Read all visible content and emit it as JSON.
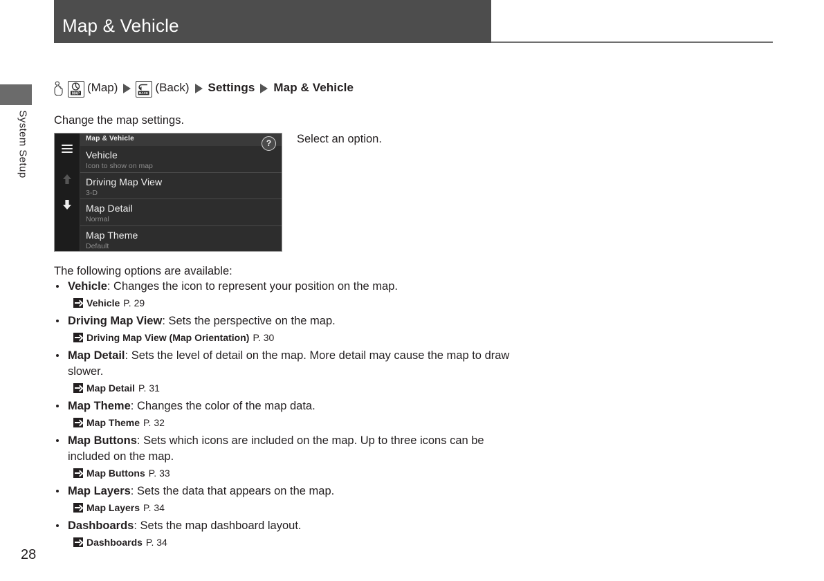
{
  "header": {
    "title": "Map & Vehicle"
  },
  "side_tab": {
    "label": "System Setup"
  },
  "breadcrumb": {
    "hand_icon": "hand-pointing-icon",
    "map_key_icon": "map-hardware-key-icon",
    "map_key_label": "MAP",
    "map_text": "(Map)",
    "back_key_icon": "back-hardware-key-icon",
    "back_key_label": "BACK",
    "back_text": "(Back)",
    "settings_text": "Settings",
    "final_text": "Map & Vehicle",
    "separator": "triangle-right-icon"
  },
  "intro": "Change the map settings.",
  "callout": "Select an option.",
  "nav_screen": {
    "title": "Map & Vehicle",
    "help_label": "?",
    "menu_icon": "hamburger-menu-icon",
    "scroll_up_icon": "arrow-up-icon",
    "scroll_down_icon": "arrow-down-icon",
    "rows": [
      {
        "title": "Vehicle",
        "subtitle": "Icon to show on map"
      },
      {
        "title": "Driving Map View",
        "subtitle": "3-D"
      },
      {
        "title": "Map Detail",
        "subtitle": "Normal"
      },
      {
        "title": "Map Theme",
        "subtitle": "Default"
      }
    ]
  },
  "options_intro": "The following options are available:",
  "options": [
    {
      "name": "Vehicle",
      "description": ": Changes the icon to represent your position on the map.",
      "ref_name": "Vehicle",
      "ref_page": "P. 29"
    },
    {
      "name": "Driving Map View",
      "description": ": Sets the perspective on the map.",
      "ref_name": "Driving Map View (Map Orientation)",
      "ref_page": "P. 30"
    },
    {
      "name": "Map Detail",
      "description": ": Sets the level of detail on the map. More detail may cause the map to draw slower.",
      "ref_name": "Map Detail",
      "ref_page": "P. 31"
    },
    {
      "name": "Map Theme",
      "description": ": Changes the color of the map data.",
      "ref_name": "Map Theme",
      "ref_page": "P. 32"
    },
    {
      "name": "Map Buttons",
      "description": ": Sets which icons are included on the map. Up to three icons can be included on the map.",
      "ref_name": "Map Buttons",
      "ref_page": "P. 33"
    },
    {
      "name": "Map Layers",
      "description": ": Sets the data that appears on the map.",
      "ref_name": "Map Layers",
      "ref_page": "P. 34"
    },
    {
      "name": "Dashboards",
      "description": ": Sets the map dashboard layout.",
      "ref_name": "Dashboards",
      "ref_page": "P. 34"
    }
  ],
  "page_number": "28",
  "colors": {
    "header_bg": "#4d4d4d",
    "text": "#231f20",
    "screen_bg": "#2d2d2d",
    "screen_sidebar": "#1c1c1c"
  }
}
